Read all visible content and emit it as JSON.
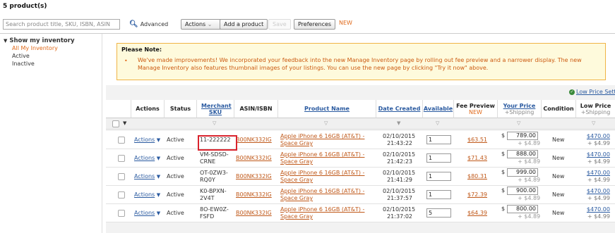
{
  "header": {
    "product_count": "5 product(s)",
    "search_placeholder": "Search product title, SKU, ISBN, ASIN",
    "search_button": "Advanced",
    "actions_label": "Actions",
    "add_product_label": "Add a product",
    "save_label": "Save",
    "preferences_label": "Preferences",
    "new_tag": "NEW"
  },
  "sidebar": {
    "title": "Show my inventory",
    "items": [
      "All My Inventory",
      "Active",
      "Inactive"
    ]
  },
  "note": {
    "title": "Please Note:",
    "body": "We've made improvements! We incorporated your feedback into the new Manage Inventory page by rolling out fee preview and a narrower display. The new Manage Inventory also features thumbnail images of your listings. You can use the new page by clicking \"Try it now\" above."
  },
  "low_price_settings": "Low Price Settings",
  "columns": {
    "actions": "Actions",
    "status": "Status",
    "merchant_sku": "Merchant SKU",
    "asin": "ASIN/ISBN",
    "product_name": "Product Name",
    "date_created": "Date Created",
    "available": "Available",
    "fee_preview": "Fee Preview",
    "fee_preview_new": "NEW",
    "your_price": "Your Price",
    "your_price_sub": "+Shipping",
    "condition": "Condition",
    "low_price": "Low Price",
    "low_price_sub": "+Shipping"
  },
  "rows": [
    {
      "actions": "Actions",
      "status": "Active",
      "sku1": "11-222222",
      "sku2": "",
      "asin": "B00NK332IG",
      "name1": "Apple iPhone 6 16GB (AT&T) -",
      "name2": "Space Gray",
      "date1": "02/10/2015",
      "date2": "21:43:22",
      "available": "1",
      "fee": "$63.51",
      "currency": "$",
      "price": "789.00",
      "ship": "+ $4.89",
      "condition": "New",
      "low_price": "$470.00",
      "low_ship": "+ $4.99"
    },
    {
      "actions": "Actions",
      "status": "Active",
      "sku1": "VM-SDSD-",
      "sku2": "CRNE",
      "asin": "B00NK332IG",
      "name1": "Apple iPhone 6 16GB (AT&T) -",
      "name2": "Space Gray",
      "date1": "02/10/2015",
      "date2": "21:42:23",
      "available": "1",
      "fee": "$71.43",
      "currency": "$",
      "price": "888.00",
      "ship": "+ $4.89",
      "condition": "New",
      "low_price": "$470.00",
      "low_ship": "+ $4.99"
    },
    {
      "actions": "Actions",
      "status": "Active",
      "sku1": "OT-0ZW3-",
      "sku2": "RQ0Y",
      "asin": "B00NK332IG",
      "name1": "Apple iPhone 6 16GB (AT&T) -",
      "name2": "Space Gray",
      "date1": "02/10/2015",
      "date2": "21:41:29",
      "available": "1",
      "fee": "$80.31",
      "currency": "$",
      "price": "999.00",
      "ship": "+ $4.89",
      "condition": "New",
      "low_price": "$470.00",
      "low_ship": "+ $4.99"
    },
    {
      "actions": "Actions",
      "status": "Active",
      "sku1": "K0-BPXN-",
      "sku2": "2V4T",
      "asin": "B00NK332IG",
      "name1": "Apple iPhone 6 16GB (AT&T) -",
      "name2": "Space Gray",
      "date1": "02/10/2015",
      "date2": "21:37:57",
      "available": "1",
      "fee": "$72.39",
      "currency": "$",
      "price": "900.00",
      "ship": "+ $4.89",
      "condition": "New",
      "low_price": "$470.00",
      "low_ship": "+ $4.99"
    },
    {
      "actions": "Actions",
      "status": "Active",
      "sku1": "8O-EW0Z-",
      "sku2": "FSFD",
      "asin": "B00NK332IG",
      "name1": "Apple iPhone 6 16GB (AT&T) -",
      "name2": "Space Gray",
      "date1": "02/10/2015",
      "date2": "21:37:02",
      "available": "5",
      "fee": "$64.39",
      "currency": "$",
      "price": "800.00",
      "ship": "+ $4.89",
      "condition": "New",
      "low_price": "$470.00",
      "low_ship": "+ $4.99"
    }
  ],
  "icons": {
    "search": "magnifier-icon",
    "sidebar_toggle": "triangle-down-icon",
    "low_price_check": "check-circle-icon",
    "filter": "funnel-icon"
  },
  "colors": {
    "link": "#2a5aa0",
    "accent": "#e06a1b",
    "note_bg": "#fefadc",
    "note_border": "#f0b445",
    "highlight": "#d9232d"
  }
}
